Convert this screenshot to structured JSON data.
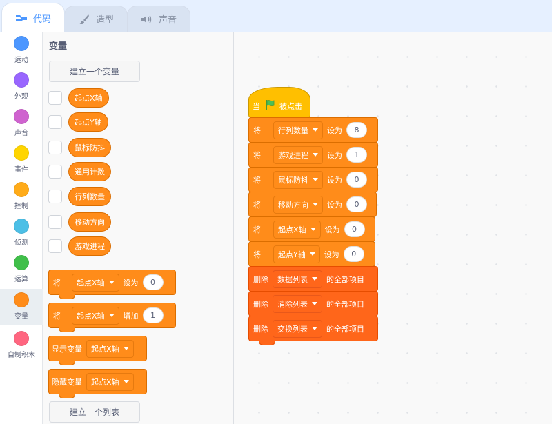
{
  "tabs": [
    {
      "label": "代码",
      "icon": "code-icon",
      "active": true
    },
    {
      "label": "造型",
      "icon": "brush-icon",
      "active": false
    },
    {
      "label": "声音",
      "icon": "speaker-icon",
      "active": false
    }
  ],
  "categories": [
    {
      "label": "运动",
      "color": "#4c97ff"
    },
    {
      "label": "外观",
      "color": "#9966ff"
    },
    {
      "label": "声音",
      "color": "#cf63cf"
    },
    {
      "label": "事件",
      "color": "#ffd500"
    },
    {
      "label": "控制",
      "color": "#ffab19"
    },
    {
      "label": "侦测",
      "color": "#4cbfe6"
    },
    {
      "label": "运算",
      "color": "#40bf4a"
    },
    {
      "label": "变量",
      "color": "#ff8c1a",
      "selected": true
    },
    {
      "label": "自制积木",
      "color": "#ff6680"
    }
  ],
  "palette": {
    "title": "变量",
    "make_variable": "建立一个变量",
    "make_list": "建立一个列表",
    "variables": [
      "起点X轴",
      "起点Y轴",
      "鼠标防抖",
      "通用计数",
      "行列数量",
      "移动方向",
      "游戏进程"
    ],
    "blocks": {
      "set": {
        "verb": "将",
        "var": "起点X轴",
        "op": "设为",
        "value": "0"
      },
      "change": {
        "verb": "将",
        "var": "起点X轴",
        "op": "增加",
        "value": "1"
      },
      "show": {
        "verb": "显示变量",
        "var": "起点X轴"
      },
      "hide": {
        "verb": "隐藏变量",
        "var": "起点X轴"
      }
    }
  },
  "script": {
    "hat": {
      "pre": "当",
      "post": "被点击",
      "icon": "green-flag-icon"
    },
    "sets": [
      {
        "verb": "将",
        "var": "行列数量",
        "op": "设为",
        "value": "8"
      },
      {
        "verb": "将",
        "var": "游戏进程",
        "op": "设为",
        "value": "1"
      },
      {
        "verb": "将",
        "var": "鼠标防抖",
        "op": "设为",
        "value": "0"
      },
      {
        "verb": "将",
        "var": "移动方向",
        "op": "设为",
        "value": "0"
      },
      {
        "verb": "将",
        "var": "起点X轴",
        "op": "设为",
        "value": "0"
      },
      {
        "verb": "将",
        "var": "起点Y轴",
        "op": "设为",
        "value": "0"
      }
    ],
    "deletes": [
      {
        "verb": "删除",
        "list": "数据列表",
        "suffix": "的全部项目"
      },
      {
        "verb": "删除",
        "list": "消除列表",
        "suffix": "的全部项目"
      },
      {
        "verb": "删除",
        "list": "交换列表",
        "suffix": "的全部项目"
      }
    ]
  }
}
